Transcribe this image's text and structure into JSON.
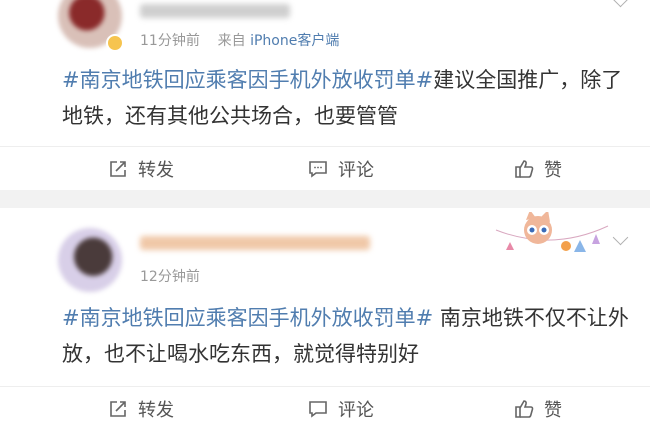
{
  "posts": [
    {
      "meta_time": "11分钟前",
      "meta_from": "来自",
      "meta_source": "iPhone客户端",
      "topic": "#南京地铁回应乘客因手机外放收罚单#",
      "text": "建议全国推广，除了地铁，还有其他公共场合，也要管管",
      "actions": {
        "repost": "转发",
        "comment": "评论",
        "like": "赞"
      }
    },
    {
      "meta_time": "12分钟前",
      "topic": "#南京地铁回应乘客因手机外放收罚单#",
      "text": " 南京地铁不仅不让外放，也不让喝水吃东西，就觉得特别好",
      "actions": {
        "repost": "转发",
        "comment": "评论",
        "like": "赞"
      }
    }
  ],
  "icons": {
    "repost": "share-edit-icon",
    "comment": "comment-bubble-icon",
    "like": "thumbs-up-icon",
    "menu": "chevron-down-icon"
  },
  "colors": {
    "topic_link": "#507daf",
    "meta_text": "#999999",
    "body_text": "#333333",
    "separator": "#f2f2f2"
  }
}
